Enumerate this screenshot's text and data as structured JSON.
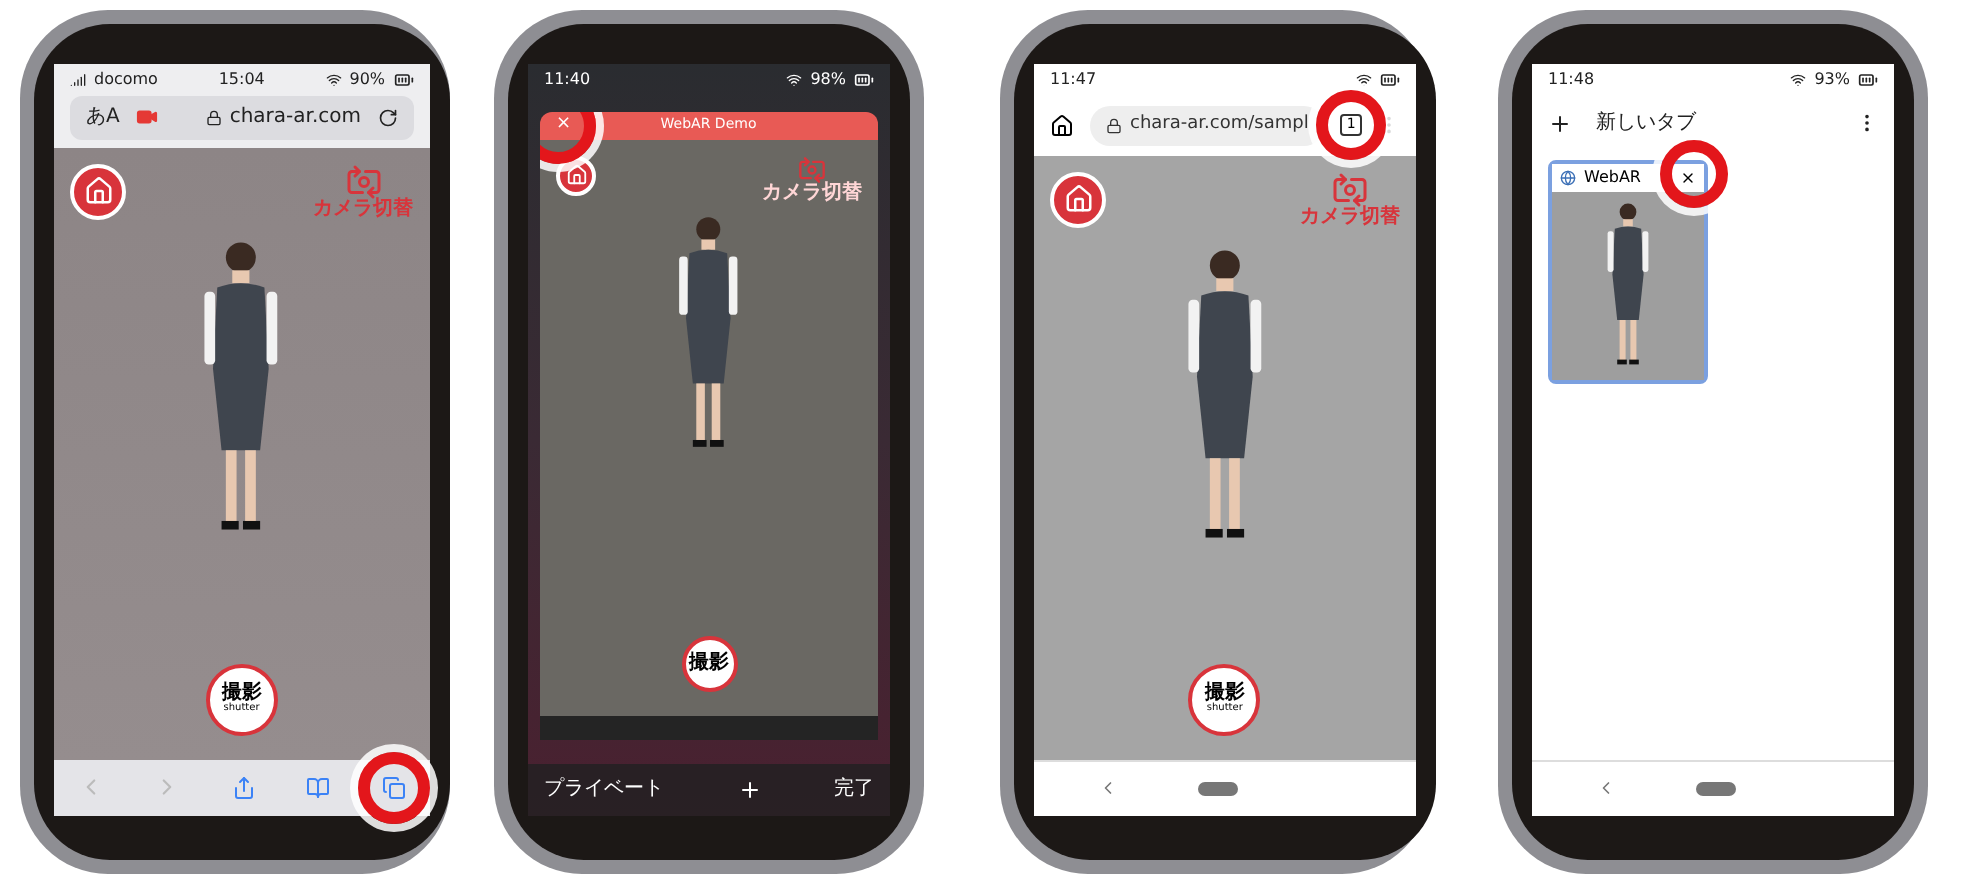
{
  "phones": [
    {
      "kind": "safari",
      "status": {
        "carrier": "docomo",
        "time": "15:04",
        "battery": "90%"
      },
      "address": {
        "text_size": "あA",
        "url": "chara-ar.com"
      },
      "ar_view": {
        "camera_switch": "カメラ切替",
        "shutter": "撮影",
        "shutter_sub": "shutter"
      },
      "toolbar": {
        "tabs_highlighted": true
      }
    },
    {
      "kind": "safari_tabs",
      "status": {
        "time": "11:40",
        "battery": "98%"
      },
      "tab": {
        "title": "WebAR Demo",
        "close": "×",
        "close_highlighted": true
      },
      "ar_view": {
        "camera_switch": "カメラ切替",
        "shutter": "撮影"
      },
      "bottom": {
        "left": "プライベート",
        "right": "完了"
      }
    },
    {
      "kind": "chrome",
      "status": {
        "time": "11:47"
      },
      "address": {
        "url": "chara-ar.com/sampl",
        "tab_count": "1",
        "highlighted": true
      },
      "ar_view": {
        "camera_switch": "カメラ切替",
        "shutter": "撮影",
        "shutter_sub": "shutter"
      }
    },
    {
      "kind": "chrome_tabs",
      "status": {
        "time": "11:48",
        "battery": "93%"
      },
      "header": {
        "title": "新しいタブ"
      },
      "tab": {
        "title": "WebAR",
        "close_highlighted": true
      }
    }
  ]
}
